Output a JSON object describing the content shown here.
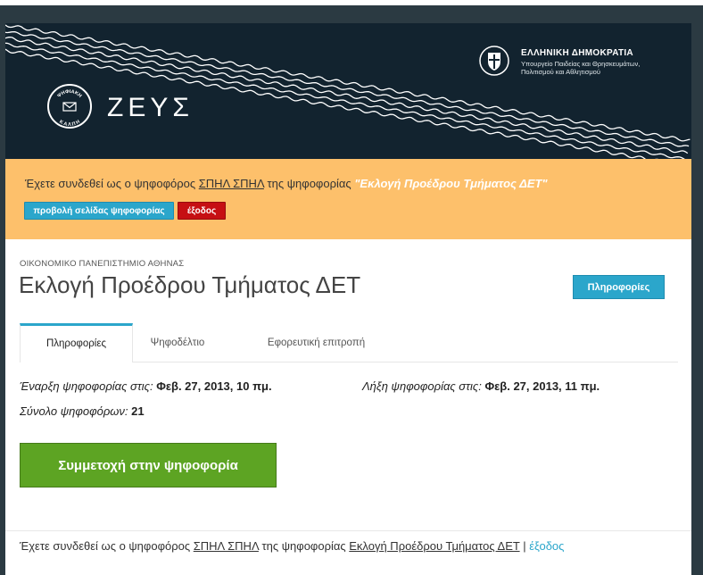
{
  "header": {
    "logo_text": "ΖΕΥΣ",
    "logo_ring_top": "ΨΗΦΙΑΚΗ",
    "logo_ring_bottom": "ΚΑΛΠΗ",
    "gov_title": "ΕΛΛΗΝΙΚΗ ΔΗΜΟΚΡΑΤΙΑ",
    "gov_sub1": "Υπουργείο Παιδείας και Θρησκευμάτων,",
    "gov_sub2": "Πολιτισμού και Αθλητισμού"
  },
  "notice": {
    "prefix": "Έχετε συνδεθεί ως ο ψηφοφόρος ",
    "voter_name": "ΣΠΗΛ ΣΠΗΛ",
    "middle": " της ψηφοφορίας ",
    "election_quoted": "\"Εκλογή Προέδρου Τμήματος ΔΕΤ\"",
    "view_button": "προβολή σελίδας ψηφοφορίας",
    "exit_button": "έξοδος"
  },
  "election": {
    "institution": "ΟΙΚΟΝΟΜΙΚΟ ΠΑΝΕΠΙΣΤΗΜΙΟ ΑΘΗΝΑΣ",
    "title": "Εκλογή Προέδρου Τμήματος ΔΕΤ",
    "info_button": "Πληροφορίες"
  },
  "tabs": [
    {
      "label": "Πληροφορίες",
      "active": true
    },
    {
      "label": "Ψηφοδέλτιο",
      "active": false
    },
    {
      "label": "Εφορευτική επιτροπή",
      "active": false
    }
  ],
  "details": {
    "start_label": "Έναρξη ψηφοφορίας στις:",
    "start_value": "Φεβ. 27, 2013, 10 πμ.",
    "end_label": "Λήξη ψηφοφορίας στις:",
    "end_value": "Φεβ. 27, 2013, 11 πμ.",
    "voters_label": "Σύνολο ψηφοφόρων:",
    "voters_value": "21"
  },
  "vote_button": "Συμμετοχή στην ψηφοφορία",
  "footer": {
    "prefix": "Έχετε συνδεθεί ως ο ψηφοφόρος ",
    "voter_name": "ΣΠΗΛ ΣΠΗΛ",
    "middle": " της ψηφοφορίας ",
    "election_name": "Εκλογή Προέδρου Τμήματος ΔΕΤ",
    "separator": " | ",
    "exit_link": "έξοδος"
  },
  "colors": {
    "header_bg": "#12232f",
    "notice_bg": "#fdc06b",
    "primary": "#2ba6cb",
    "danger": "#c60f13",
    "success": "#5da423"
  }
}
